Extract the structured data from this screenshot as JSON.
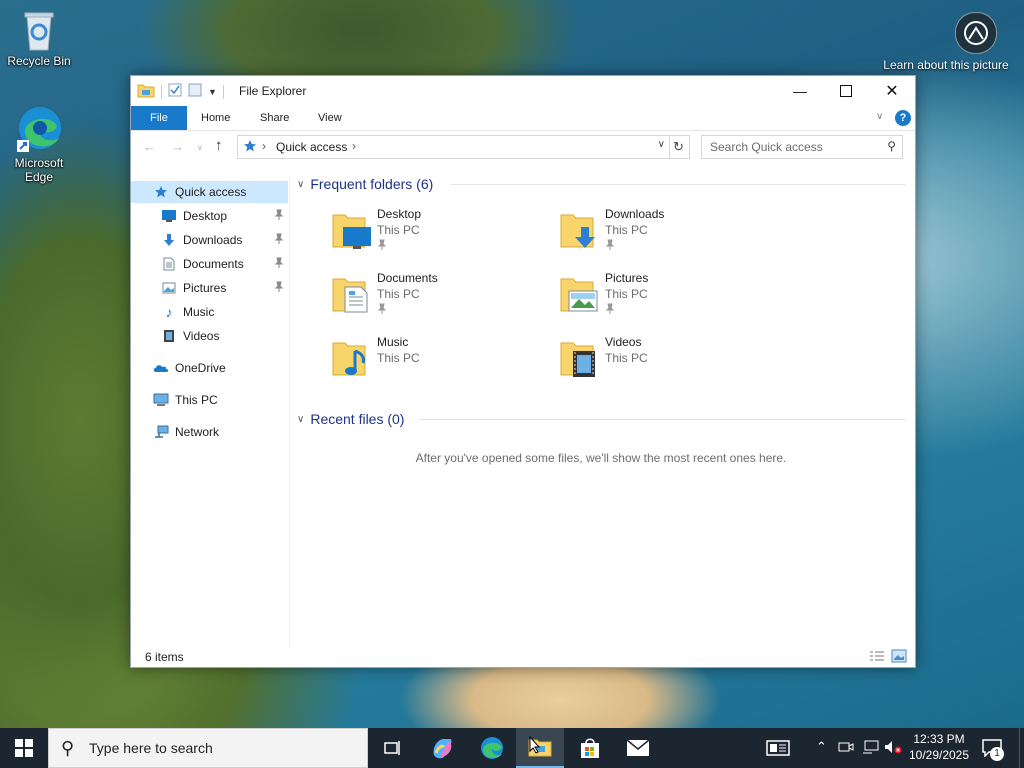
{
  "desktop": {
    "icons": [
      {
        "label": "Recycle Bin"
      },
      {
        "label": "Microsoft Edge"
      }
    ],
    "learn_about": "Learn about this picture"
  },
  "window": {
    "title": "File Explorer",
    "ribbon_tabs": [
      "File",
      "Home",
      "Share",
      "View"
    ],
    "address": {
      "path": [
        "Quick access"
      ]
    },
    "search_placeholder": "Search Quick access",
    "nav": {
      "quick_access": "Quick access",
      "pinned": [
        "Desktop",
        "Downloads",
        "Documents",
        "Pictures"
      ],
      "unpinned": [
        "Music",
        "Videos"
      ],
      "onedrive": "OneDrive",
      "this_pc": "This PC",
      "network": "Network"
    },
    "frequent": {
      "header": "Frequent folders (6)",
      "folders": [
        {
          "name": "Desktop",
          "location": "This PC",
          "pinned": true
        },
        {
          "name": "Downloads",
          "location": "This PC",
          "pinned": true
        },
        {
          "name": "Documents",
          "location": "This PC",
          "pinned": true
        },
        {
          "name": "Pictures",
          "location": "This PC",
          "pinned": true
        },
        {
          "name": "Music",
          "location": "This PC",
          "pinned": false
        },
        {
          "name": "Videos",
          "location": "This PC",
          "pinned": false
        }
      ]
    },
    "recent": {
      "header": "Recent files (0)",
      "empty_text": "After you've opened some files, we'll show the most recent ones here."
    },
    "status": {
      "count": "6 items"
    }
  },
  "taskbar": {
    "search_placeholder": "Type here to search",
    "clock": {
      "time": "12:33 PM",
      "date": "10/29/2025"
    },
    "notification_count": "1"
  },
  "colors": {
    "accent": "#1979ca",
    "selection": "#cce8ff",
    "section_header": "#1e3287",
    "folder": "#f7d56b"
  }
}
